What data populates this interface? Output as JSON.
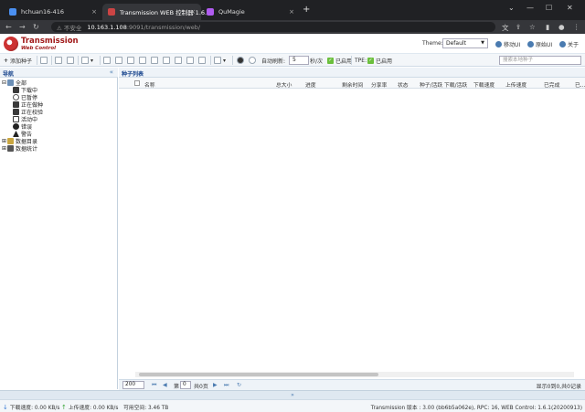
{
  "browser": {
    "tabs": [
      {
        "title": "hchuan16-416",
        "active": false,
        "favicon_color": "#4a8ff0"
      },
      {
        "title": "Transmission WEB 控制器 1.6.1",
        "active": true,
        "favicon_color": "#c44"
      },
      {
        "title": "QuMagie",
        "active": false,
        "favicon_color": "#b05cf0"
      }
    ],
    "new_tab": "+",
    "tab_close": "×",
    "address": {
      "security": "不安全",
      "host": "10.163.1.108",
      "path": ":9091/transmission/web/"
    }
  },
  "app": {
    "brand": "Transmission",
    "brand_sub": "Web Control",
    "theme_label": "Theme:",
    "theme_value": "Default",
    "links": [
      {
        "label": "移动UI",
        "color": "#4a7bb0"
      },
      {
        "label": "原始UI",
        "color": "#4a7bb0"
      },
      {
        "label": "关于",
        "color": "#4a7bb0"
      }
    ]
  },
  "toolbar": {
    "add_torrent": "添加种子",
    "auto_refresh_label": "自动刷新:",
    "refresh_interval": "5",
    "interval_unit": "秒/次",
    "enabled1": "已启用",
    "tpe_label": "TPE:",
    "enabled2": "已启用",
    "search_placeholder": "搜索本地种子"
  },
  "nav": {
    "title": "导航",
    "collapse": "«",
    "items": [
      {
        "label": "全部",
        "indent": 0,
        "color": "#6c8fb6",
        "toggle": "⊟"
      },
      {
        "label": "下载中",
        "indent": 1,
        "color": "#3a3a3a"
      },
      {
        "label": "已暂停",
        "indent": 1,
        "color": "#555555"
      },
      {
        "label": "正在做种",
        "indent": 1,
        "color": "#3a3a3a"
      },
      {
        "label": "正在校验",
        "indent": 1,
        "color": "#3a3a3a"
      },
      {
        "label": "活动中",
        "indent": 1,
        "color": "#3a3a3a"
      },
      {
        "label": "错误",
        "indent": 1,
        "color": "#222222"
      },
      {
        "label": "警告",
        "indent": 1,
        "color": "#222222"
      },
      {
        "label": "数据目录",
        "indent": 0,
        "color": "#c9a640",
        "toggle": "⊞"
      },
      {
        "label": "数据统计",
        "indent": 0,
        "color": "#555555",
        "toggle": "⊞"
      }
    ]
  },
  "torrent_list": {
    "title": "种子列表",
    "columns": [
      "名称",
      "总大小",
      "进度",
      "剩余时间",
      "分享率",
      "状态",
      "种子/活跃",
      "下载/活跃",
      "下载速度",
      "上传速度",
      "已完成",
      "已..."
    ]
  },
  "pager": {
    "page_size": "200",
    "page_label": "第",
    "page_value": "0",
    "total_pages": "共0页",
    "summary": "显示0到0,共0记录",
    "first": "⏮",
    "prev": "◀",
    "next": "▶",
    "last": "⏭",
    "refresh": "↻"
  },
  "splitter": "»",
  "status": {
    "download_label": "下载速度:",
    "download_value": "0.00 KB/s",
    "upload_label": "上传速度:",
    "upload_value": "0.00 KB/s",
    "free_label": "可用空间:",
    "free_value": "3.46 TB",
    "version": "Transmission 版本 : 3.00 (bb6b5a062e), RPC: 16, WEB Control: 1.6.1(20200913)"
  }
}
